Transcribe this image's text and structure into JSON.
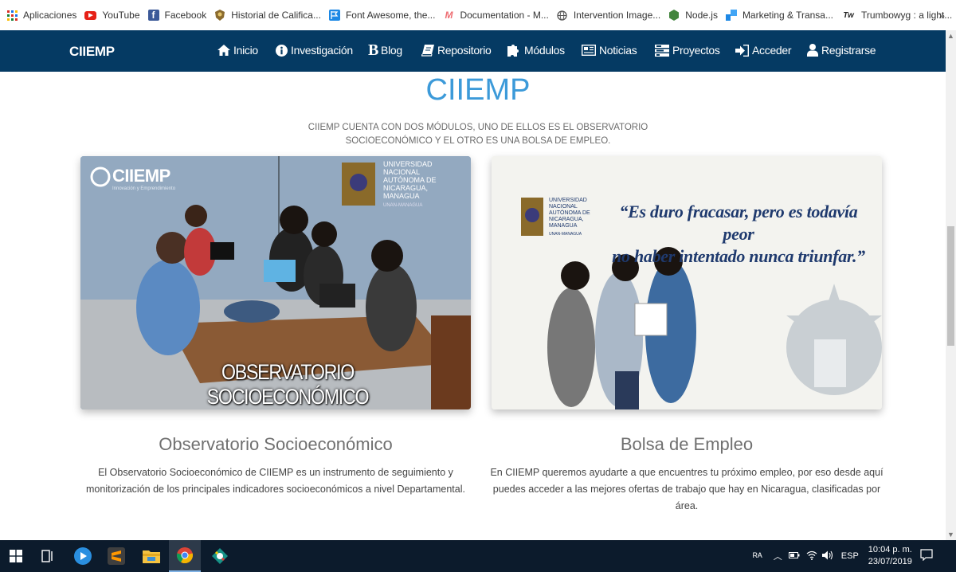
{
  "bookmarks": [
    {
      "label": "Aplicaciones",
      "icon": "apps-grid-icon"
    },
    {
      "label": "YouTube",
      "icon": "youtube-icon"
    },
    {
      "label": "Facebook",
      "icon": "facebook-icon"
    },
    {
      "label": "Historial de Califica...",
      "icon": "university-seal-icon"
    },
    {
      "label": "Font Awesome, the...",
      "icon": "flag-icon"
    },
    {
      "label": "Documentation - M...",
      "icon": "materialize-icon"
    },
    {
      "label": "Intervention Image...",
      "icon": "globe-icon"
    },
    {
      "label": "Node.js",
      "icon": "nodejs-icon"
    },
    {
      "label": "Marketing & Transa...",
      "icon": "marketing-icon"
    },
    {
      "label": "Trumbowyg : a light...",
      "icon": "trumbowyg-icon"
    }
  ],
  "bookmarks_more": "»",
  "nav": {
    "brand": "CIIEMP",
    "items": [
      {
        "label": "Inicio",
        "icon": "home-icon"
      },
      {
        "label": "Investigación",
        "icon": "info-circle-icon"
      },
      {
        "label": "Blog",
        "icon": "bold-b-icon"
      },
      {
        "label": "Repositorio",
        "icon": "book-icon"
      },
      {
        "label": "Módulos",
        "icon": "puzzle-icon"
      },
      {
        "label": "Noticias",
        "icon": "newspaper-icon"
      },
      {
        "label": "Proyectos",
        "icon": "tasks-icon"
      },
      {
        "label": "Acceder",
        "icon": "sign-in-icon"
      },
      {
        "label": "Registrarse",
        "icon": "user-icon"
      }
    ]
  },
  "main": {
    "title": "CIIEMP",
    "intro": "CIIEMP cuenta con dos módulos, uno de ellos es el observatorio socioeconómico y el otro es una bolsa de empleo.",
    "cards": [
      {
        "image_logo": "CIIEMP",
        "image_logo_sub": "Innovación y Emprendimiento",
        "image_univ": [
          "UNIVERSIDAD",
          "NACIONAL",
          "AUTÓNOMA DE",
          "NICARAGUA,",
          "MANAGUA"
        ],
        "image_univ_sub": "UNAN-MANAGUA",
        "image_caption": "OBSERVATORIO SOCIOECONÓMICO",
        "title": "Observatorio Socioeconómico",
        "description": "El Observatorio Socioeconómico de CIIEMP es un instrumento de seguimiento y monitorización de los principales indicadores socioeconómicos a nivel Departamental."
      },
      {
        "image_univ": [
          "UNIVERSIDAD",
          "NACIONAL",
          "AUTÓNOMA DE",
          "NICARAGUA,",
          "MANAGUA"
        ],
        "image_univ_sub": "UNAN-MANAGUA",
        "image_quote_line1": "“Es duro fracasar, pero es todavía peor",
        "image_quote_line2": "no haber intentado nunca triunfar.”",
        "title": "Bolsa de Empleo",
        "description": "En CIIEMP queremos ayudarte a que encuentres tu próximo empleo, por eso desde aquí puedes acceder a las mejores ofertas de trabajo que hay en Nicaragua, clasificadas por área."
      }
    ]
  },
  "taskbar": {
    "apps": [
      "windows-start-icon",
      "task-view-icon",
      "media-player-icon",
      "sublime-text-icon",
      "file-explorer-icon",
      "chrome-icon",
      "gitkraken-icon"
    ],
    "language": "ESP",
    "time": "10:04 p. m.",
    "date": "23/07/2019"
  },
  "colors": {
    "nav_bg": "#053a63",
    "title_blue": "#3c9ad9",
    "taskbar_bg": "#0c1b2c"
  }
}
